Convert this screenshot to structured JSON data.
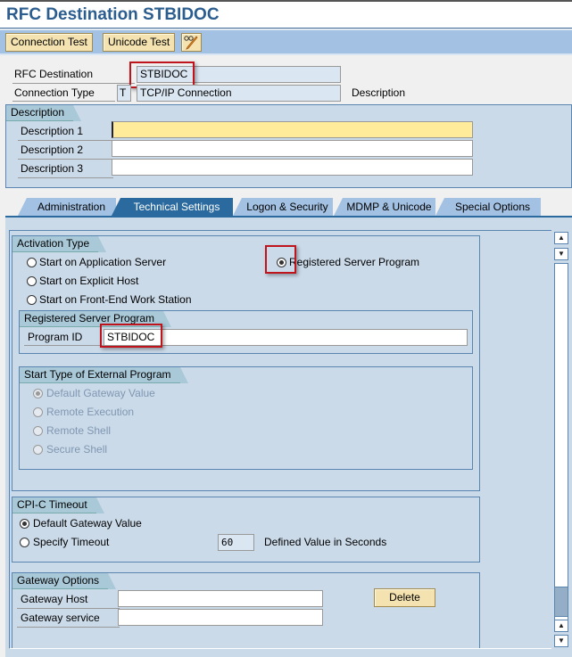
{
  "window": {
    "title": "RFC Destination STBIDOC"
  },
  "toolbar": {
    "connection_test_label": "Connection Test",
    "unicode_test_label": "Unicode Test",
    "edit_icon": "pencil-glasses-icon"
  },
  "header": {
    "rfc_destination_label": "RFC Destination",
    "rfc_destination_value": "STBIDOC",
    "connection_type_label": "Connection Type",
    "connection_type_code": "T",
    "connection_type_value": "TCP/IP Connection",
    "description_label": "Description"
  },
  "description": {
    "title": "Description",
    "fields": [
      {
        "label": "Description 1",
        "value": ""
      },
      {
        "label": "Description 2",
        "value": ""
      },
      {
        "label": "Description 3",
        "value": ""
      }
    ]
  },
  "tabs": [
    {
      "label": "Administration",
      "active": false
    },
    {
      "label": "Technical Settings",
      "active": true
    },
    {
      "label": "Logon & Security",
      "active": false
    },
    {
      "label": "MDMP & Unicode",
      "active": false
    },
    {
      "label": "Special Options",
      "active": false
    }
  ],
  "activation_type": {
    "title": "Activation Type",
    "options": [
      {
        "label": "Start on Application Server",
        "selected": false
      },
      {
        "label": "Registered Server Program",
        "selected": true
      },
      {
        "label": "Start on Explicit Host",
        "selected": false
      },
      {
        "label": "Start on Front-End Work Station",
        "selected": false
      }
    ]
  },
  "registered_server_program": {
    "title": "Registered Server Program",
    "program_id_label": "Program ID",
    "program_id_value": "STBIDOC"
  },
  "start_type": {
    "title": "Start Type of External Program",
    "options": [
      {
        "label": "Default Gateway Value",
        "selected": true,
        "disabled": true
      },
      {
        "label": "Remote Execution",
        "selected": false,
        "disabled": true
      },
      {
        "label": "Remote Shell",
        "selected": false,
        "disabled": true
      },
      {
        "label": "Secure Shell",
        "selected": false,
        "disabled": true
      }
    ]
  },
  "cpic_timeout": {
    "title": "CPI-C Timeout",
    "options": [
      {
        "label": "Default Gateway Value",
        "selected": true
      },
      {
        "label": "Specify Timeout",
        "selected": false
      }
    ],
    "timeout_value": "60",
    "timeout_unit_label": "Defined Value in Seconds"
  },
  "gateway_options": {
    "title": "Gateway Options",
    "host_label": "Gateway Host",
    "host_value": "",
    "service_label": "Gateway service",
    "service_value": "",
    "delete_label": "Delete"
  },
  "scrollbar": {
    "up": "▲",
    "down": "▼"
  }
}
